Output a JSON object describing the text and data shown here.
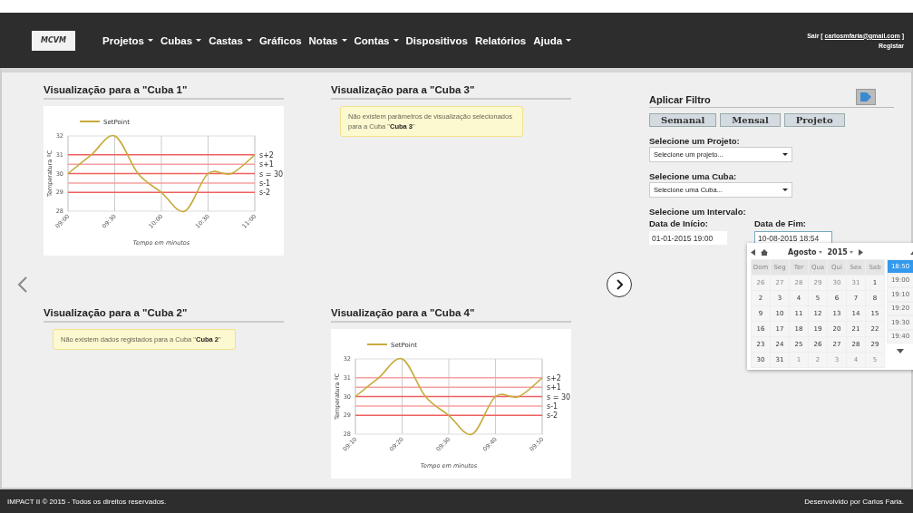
{
  "header": {
    "logo": "MCVM",
    "nav": [
      {
        "label": "Projetos",
        "dropdown": true
      },
      {
        "label": "Cubas",
        "dropdown": true
      },
      {
        "label": "Castas",
        "dropdown": true
      },
      {
        "label": "Gráficos",
        "dropdown": false
      },
      {
        "label": "Notas",
        "dropdown": true
      },
      {
        "label": "Contas",
        "dropdown": true
      },
      {
        "label": "Dispositivos",
        "dropdown": false
      },
      {
        "label": "Relatórios",
        "dropdown": false
      },
      {
        "label": "Ajuda",
        "dropdown": true
      }
    ],
    "user": {
      "prefix": "Sair [",
      "email": "carlosmfaria@gmail.com",
      "suffix": "]",
      "register": "Registar"
    }
  },
  "panels": [
    {
      "title": "Visualização para a \"Cuba 1\"",
      "kind": "chart",
      "chart_data": {
        "type": "line",
        "xlabel": "Tempo em minutos",
        "ylabel": "Temperatura ºC",
        "categories": [
          "09:00",
          null,
          "09:30",
          null,
          "10:00",
          null,
          "10:30",
          null,
          "11:00"
        ],
        "ylim": [
          28,
          32
        ],
        "yticks": [
          28,
          29,
          30,
          31,
          32
        ],
        "grid": true,
        "series": [
          {
            "name": "SetPoint",
            "color": "#c8aa3c",
            "values": [
              30,
              31,
              32,
              30,
              29,
              28,
              30,
              30,
              31
            ]
          },
          {
            "name": "s+2",
            "color": "#f06060",
            "values": [
              31,
              31,
              31,
              31,
              31,
              31,
              31,
              31,
              31
            ]
          },
          {
            "name": "s+1",
            "color": "#f4a0a0",
            "values": [
              30.5,
              30.5,
              30.5,
              30.5,
              30.5,
              30.5,
              30.5,
              30.5,
              30.5
            ]
          },
          {
            "name": "s = 30",
            "color": "#f06060",
            "values": [
              30,
              30,
              30,
              30,
              30,
              30,
              30,
              30,
              30
            ]
          },
          {
            "name": "s-1",
            "color": "#f4a0a0",
            "values": [
              29.5,
              29.5,
              29.5,
              29.5,
              29.5,
              29.5,
              29.5,
              29.5,
              29.5
            ]
          },
          {
            "name": "s-2",
            "color": "#f06060",
            "values": [
              29,
              29,
              29,
              29,
              29,
              29,
              29,
              29,
              29
            ]
          }
        ]
      }
    },
    {
      "title": "Visualização para a \"Cuba 3\"",
      "kind": "message",
      "message": "Não existem parâmetros de visualização selecionados para a Cuba \"**Cuba 3**\""
    },
    {
      "title": "Visualização para a \"Cuba 2\"",
      "kind": "message",
      "message": "Não existem dados registados para a Cuba \"**Cuba 2**\""
    },
    {
      "title": "Visualização para a \"Cuba 4\"",
      "kind": "chart",
      "chart_data": {
        "type": "line",
        "xlabel": "Tempo em minutos",
        "ylabel": "Temperatura ºC",
        "categories": [
          "09:10",
          null,
          "09:20",
          null,
          "09:30",
          null,
          "09:40",
          null,
          "09:50"
        ],
        "ylim": [
          28,
          32
        ],
        "yticks": [
          28,
          29,
          30,
          31,
          32
        ],
        "grid": true,
        "series": [
          {
            "name": "SetPoint",
            "color": "#c8aa3c",
            "values": [
              30,
              31,
              32,
              30,
              29,
              28,
              30,
              30,
              31
            ]
          },
          {
            "name": "s+2",
            "color": "#f4a0a0",
            "values": [
              31,
              31,
              31,
              31,
              31,
              31,
              31,
              31,
              31
            ]
          },
          {
            "name": "s+1",
            "color": "#f4a0a0",
            "values": [
              30.5,
              30.5,
              30.5,
              30.5,
              30.5,
              30.5,
              30.5,
              30.5,
              30.5
            ]
          },
          {
            "name": "s = 30",
            "color": "#f06060",
            "values": [
              30,
              30,
              30,
              30,
              30,
              30,
              30,
              30,
              30
            ]
          },
          {
            "name": "s-1",
            "color": "#f4a0a0",
            "values": [
              29.5,
              29.5,
              29.5,
              29.5,
              29.5,
              29.5,
              29.5,
              29.5,
              29.5
            ]
          },
          {
            "name": "s-2",
            "color": "#f06060",
            "values": [
              29,
              29,
              29,
              29,
              29,
              29,
              29,
              29,
              29
            ]
          }
        ]
      }
    }
  ],
  "filter": {
    "title": "Aplicar Filtro",
    "periods": [
      "Semanal",
      "Mensal",
      "Projeto"
    ],
    "project": {
      "label": "Selecione um Projeto:",
      "value": "Selecione um projeto..."
    },
    "cuba": {
      "label": "Selecione uma Cuba:",
      "value": "Selecione uma Cuba..."
    },
    "interval": {
      "label": "Selecione um Intervalo:",
      "start_label": "Data de Início:",
      "start": "01-01-2015  19:00",
      "end_label": "Data de Fim:",
      "end": "10-08-2015  18:54"
    }
  },
  "calendar": {
    "month": "Agosto",
    "year": "2015",
    "weekdays": [
      "Dom",
      "Seg",
      "Ter",
      "Qua",
      "Qui",
      "Sex",
      "Sab"
    ],
    "weeks": [
      [
        {
          "day": "26",
          "other_month": true
        },
        {
          "day": "27",
          "other_month": true
        },
        {
          "day": "28",
          "other_month": true
        },
        {
          "day": "29",
          "other_month": true
        },
        {
          "day": "30",
          "other_month": true
        },
        {
          "day": "31",
          "other_month": true
        },
        {
          "day": "1",
          "other_month": false
        }
      ],
      [
        {
          "day": "2",
          "other_month": false
        },
        {
          "day": "3",
          "other_month": false
        },
        {
          "day": "4",
          "other_month": false
        },
        {
          "day": "5",
          "other_month": false
        },
        {
          "day": "6",
          "other_month": false
        },
        {
          "day": "7",
          "other_month": false
        },
        {
          "day": "8",
          "other_month": false
        }
      ],
      [
        {
          "day": "9",
          "other_month": false
        },
        {
          "day": "10",
          "other_month": false
        },
        {
          "day": "11",
          "other_month": false
        },
        {
          "day": "12",
          "other_month": false
        },
        {
          "day": "13",
          "other_month": false
        },
        {
          "day": "14",
          "other_month": false
        },
        {
          "day": "15",
          "other_month": false
        }
      ],
      [
        {
          "day": "16",
          "other_month": false
        },
        {
          "day": "17",
          "other_month": false
        },
        {
          "day": "18",
          "other_month": false
        },
        {
          "day": "19",
          "other_month": false
        },
        {
          "day": "20",
          "other_month": false
        },
        {
          "day": "21",
          "other_month": false
        },
        {
          "day": "22",
          "other_month": false
        }
      ],
      [
        {
          "day": "23",
          "other_month": false
        },
        {
          "day": "24",
          "other_month": false
        },
        {
          "day": "25",
          "other_month": false
        },
        {
          "day": "26",
          "other_month": false
        },
        {
          "day": "27",
          "other_month": false
        },
        {
          "day": "28",
          "other_month": false
        },
        {
          "day": "29",
          "other_month": false
        }
      ],
      [
        {
          "day": "30",
          "other_month": false
        },
        {
          "day": "31",
          "other_month": false
        },
        {
          "day": "1",
          "other_month": true
        },
        {
          "day": "2",
          "other_month": true
        },
        {
          "day": "3",
          "other_month": true
        },
        {
          "day": "4",
          "other_month": true
        },
        {
          "day": "5",
          "other_month": true
        }
      ]
    ],
    "times": [
      {
        "label": "18:50",
        "selected": true
      },
      {
        "label": "19:00",
        "selected": false
      },
      {
        "label": "19:10",
        "selected": false
      },
      {
        "label": "19:20",
        "selected": false
      },
      {
        "label": "19:30",
        "selected": false
      },
      {
        "label": "19:40",
        "selected": false
      }
    ]
  },
  "footer": {
    "left": "IMPACT II © 2015 - Todos os direitos reservados.",
    "right": "Desenvolvido por Carlos Faria."
  }
}
